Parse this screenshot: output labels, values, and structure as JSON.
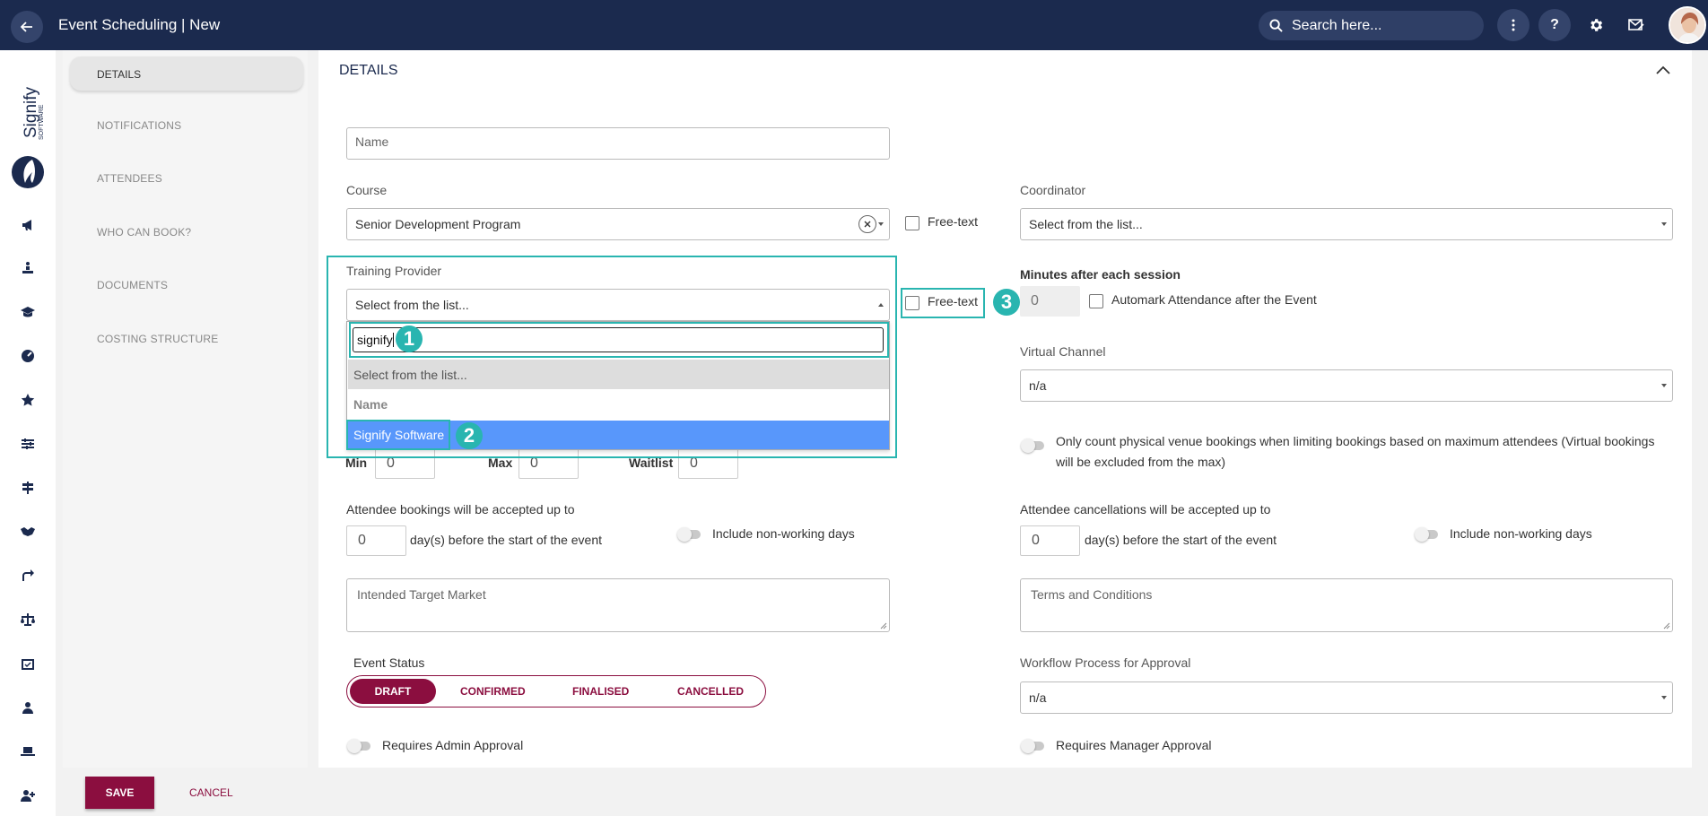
{
  "header": {
    "title": "Event Scheduling | New",
    "search_placeholder": "Search here..."
  },
  "logo": {
    "text": "Signify",
    "subtext": "SOFTWARE"
  },
  "section_nav": {
    "items": [
      "DETAILS",
      "NOTIFICATIONS",
      "ATTENDEES",
      "WHO CAN BOOK?",
      "DOCUMENTS",
      "COSTING STRUCTURE"
    ]
  },
  "section": {
    "title": "DETAILS"
  },
  "form": {
    "name_placeholder": "Name",
    "course_label": "Course",
    "course_value": "Senior Development Program",
    "free_text_label": "Free-text",
    "coordinator_label": "Coordinator",
    "coordinator_placeholder": "Select from the list...",
    "training_provider_label": "Training Provider",
    "training_provider_placeholder": "Select from the list...",
    "minutes_label": "Minutes after each session",
    "minutes_value": "0",
    "automark_label": "Automark Attendance after the Event",
    "virtual_channel_label": "Virtual Channel",
    "virtual_channel_value": "n/a",
    "physical_venue_text": "Only count physical venue bookings when limiting bookings based on maximum attendees (Virtual bookings will be excluded from the max)",
    "min_label": "Min",
    "min_value": "0",
    "max_label": "Max",
    "max_value": "0",
    "waitlist_label": "Waitlist",
    "waitlist_value": "0",
    "bookings_label": "Attendee bookings will be accepted up to",
    "bookings_value": "0",
    "bookings_suffix": "day(s) before the start of the event",
    "non_working_label": "Include non-working days",
    "cancellations_label": "Attendee cancellations will be accepted up to",
    "cancellations_value": "0",
    "cancellations_suffix": "day(s) before the start of the event",
    "target_market_placeholder": "Intended Target Market",
    "terms_placeholder": "Terms and Conditions",
    "event_status_label": "Event Status",
    "statuses": [
      "DRAFT",
      "CONFIRMED",
      "FINALISED",
      "CANCELLED"
    ],
    "workflow_label": "Workflow Process for Approval",
    "workflow_value": "n/a",
    "admin_approval_label": "Requires Admin Approval",
    "manager_approval_label": "Requires Manager Approval"
  },
  "dropdown": {
    "search_value": "signify",
    "option_default": "Select from the list...",
    "group_label": "Name",
    "option_selected": "Signify Software"
  },
  "annotations": [
    "1",
    "2",
    "3"
  ],
  "footer": {
    "save_label": "SAVE",
    "cancel_label": "CANCEL"
  },
  "colors": {
    "header_bg": "#1b2a4e",
    "accent": "#8b0e3f",
    "annotation": "#29b5b0",
    "selected_option": "#5897fb"
  }
}
